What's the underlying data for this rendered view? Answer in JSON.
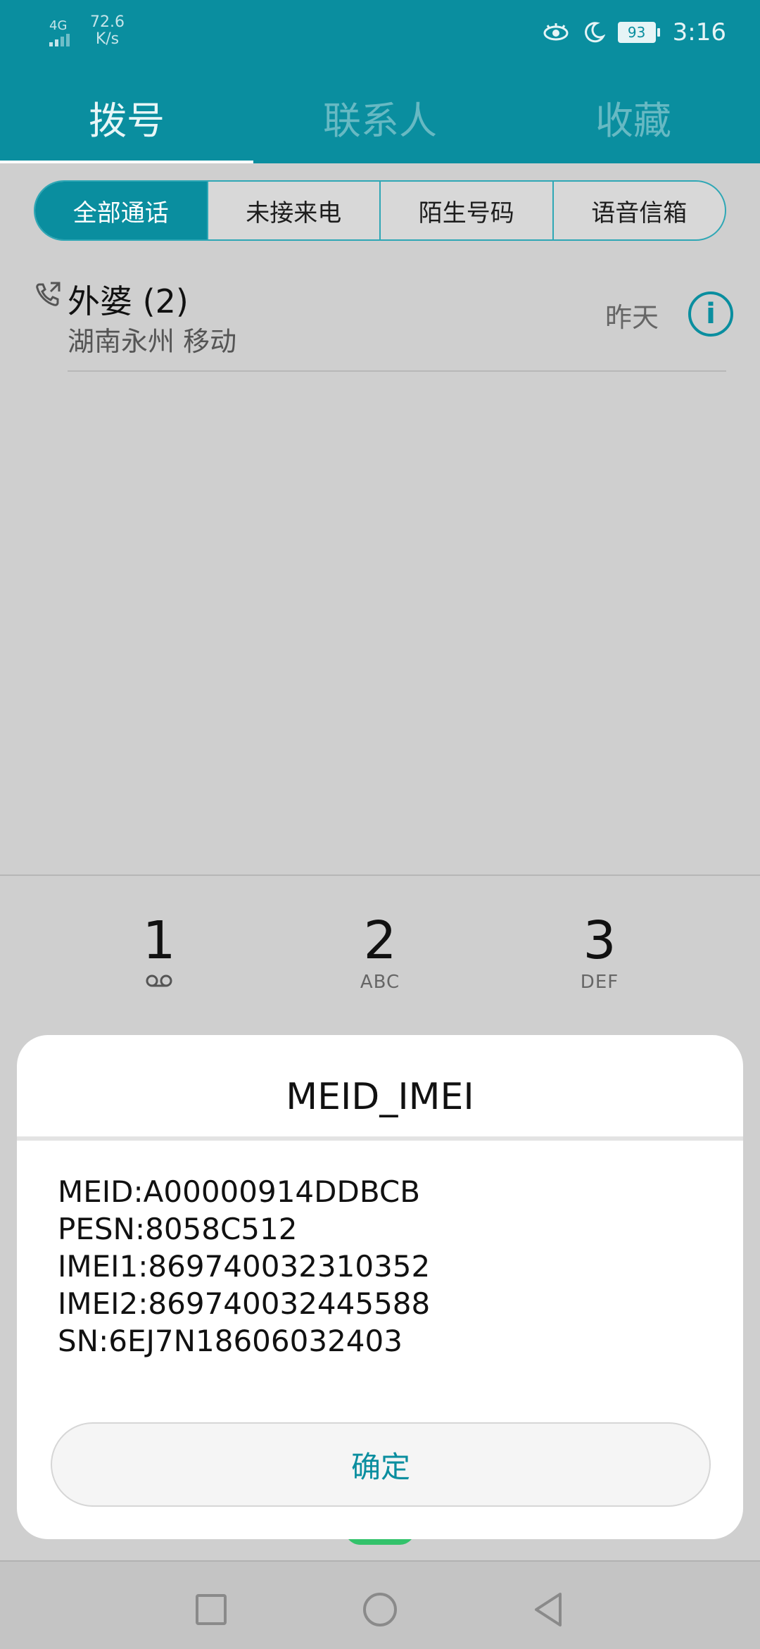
{
  "status": {
    "network": "4G",
    "speed_value": "72.6",
    "speed_unit": "K/s",
    "battery": "93",
    "time": "3:16"
  },
  "tabs": [
    {
      "label": "拨号",
      "active": true
    },
    {
      "label": "联系人",
      "active": false
    },
    {
      "label": "收藏",
      "active": false
    }
  ],
  "filters": [
    {
      "label": "全部通话",
      "active": true
    },
    {
      "label": "未接来电",
      "active": false
    },
    {
      "label": "陌生号码",
      "active": false
    },
    {
      "label": "语音信箱",
      "active": false
    }
  ],
  "call_log": [
    {
      "name": "外婆 (2)",
      "location": "湖南永州 移动",
      "time": "昨天"
    }
  ],
  "dialpad": {
    "keys": [
      {
        "digit": "1",
        "letters": ""
      },
      {
        "digit": "2",
        "letters": "ABC"
      },
      {
        "digit": "3",
        "letters": "DEF"
      }
    ]
  },
  "dialog": {
    "title": "MEID_IMEI",
    "lines": [
      "MEID:A00000914DDBCB",
      "PESN:8058C512",
      "IMEI1:869740032310352",
      "IMEI2:869740032445588",
      "SN:6EJ7N18606032403"
    ],
    "ok_label": "确定"
  },
  "colors": {
    "accent": "#0a8e9f",
    "call_green": "#33c26b"
  }
}
